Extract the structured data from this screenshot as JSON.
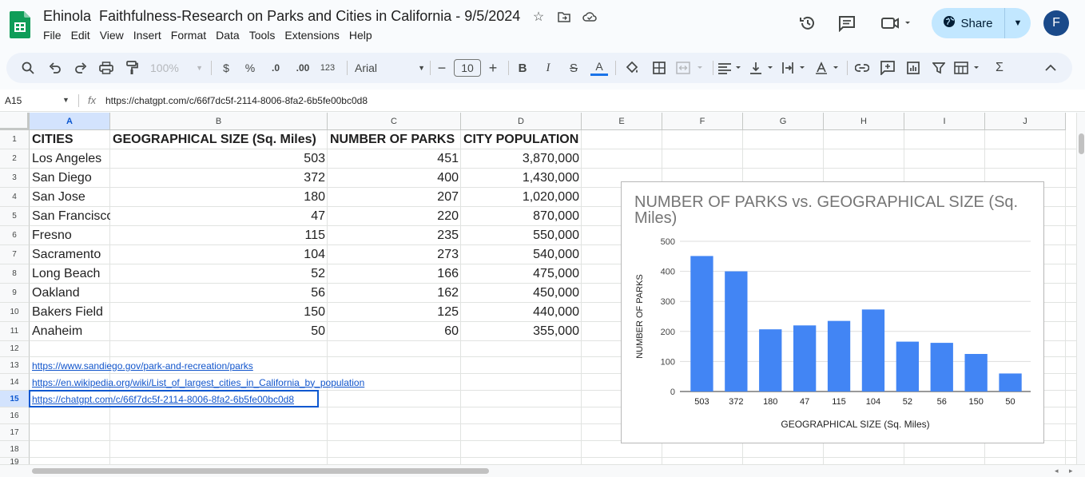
{
  "document": {
    "title": "Ehinola  Faithfulness-Research on Parks and Cities in California - 9/5/2024"
  },
  "menu": [
    "File",
    "Edit",
    "View",
    "Insert",
    "Format",
    "Data",
    "Tools",
    "Extensions",
    "Help"
  ],
  "share": {
    "label": "Share"
  },
  "avatar": {
    "initial": "F"
  },
  "toolbar": {
    "zoom": "100%",
    "currency": "$",
    "percent": "%",
    "decrease_decimal": ".0",
    "increase_decimal": ".00",
    "number_format": "123",
    "font": "Arial",
    "font_size": "10"
  },
  "formula_bar": {
    "cell_ref": "A15",
    "fx": "fx",
    "content": "https://chatgpt.com/c/66f7dc5f-2114-8006-8fa2-6b5fe00bc0d8"
  },
  "columns": [
    "A",
    "B",
    "C",
    "D",
    "E",
    "F",
    "G",
    "H",
    "I",
    "J"
  ],
  "rows": [
    "1",
    "2",
    "3",
    "4",
    "5",
    "6",
    "7",
    "8",
    "9",
    "10",
    "11",
    "12",
    "13",
    "14",
    "15",
    "16",
    "17",
    "18",
    "19"
  ],
  "table": {
    "headers": [
      "CITIES",
      "GEOGRAPHICAL SIZE (Sq. Miles)",
      "NUMBER OF PARKS",
      "CITY POPULATION"
    ],
    "rows": [
      [
        "Los Angeles",
        "503",
        "451",
        "3,870,000"
      ],
      [
        "San Diego",
        "372",
        "400",
        "1,430,000"
      ],
      [
        "San Jose",
        "180",
        "207",
        "1,020,000"
      ],
      [
        "San Francisco",
        "47",
        "220",
        "870,000"
      ],
      [
        "Fresno",
        "115",
        "235",
        "550,000"
      ],
      [
        "Sacramento",
        "104",
        "273",
        "540,000"
      ],
      [
        "Long Beach",
        "52",
        "166",
        "475,000"
      ],
      [
        "Oakland",
        "56",
        "162",
        "450,000"
      ],
      [
        "Bakers Field",
        "150",
        "125",
        "440,000"
      ],
      [
        "Anaheim",
        "50",
        "60",
        "355,000"
      ]
    ]
  },
  "links": [
    "https://www.sandiego.gov/park-and-recreation/parks",
    "https://en.wikipedia.org/wiki/List_of_largest_cities_in_California_by_population",
    "https://chatgpt.com/c/66f7dc5f-2114-8006-8fa2-6b5fe00bc0d8"
  ],
  "chart_data": {
    "type": "bar",
    "title": "NUMBER OF PARKS vs. GEOGRAPHICAL SIZE (Sq. Miles)",
    "xlabel": "GEOGRAPHICAL SIZE (Sq. Miles)",
    "ylabel": "NUMBER OF PARKS",
    "categories": [
      "503",
      "372",
      "180",
      "47",
      "115",
      "104",
      "52",
      "56",
      "150",
      "50"
    ],
    "values": [
      451,
      400,
      207,
      220,
      235,
      273,
      166,
      162,
      125,
      60
    ],
    "ylim": [
      0,
      500
    ],
    "yticks": [
      "0",
      "100",
      "200",
      "300",
      "400",
      "500"
    ],
    "bar_color": "#4285f4",
    "grid": true,
    "legend": "none"
  },
  "colors": {
    "accent": "#0b57d0",
    "share_bg": "#c2e7ff",
    "link": "#1155cc",
    "sheets_green": "#0f9d58"
  }
}
